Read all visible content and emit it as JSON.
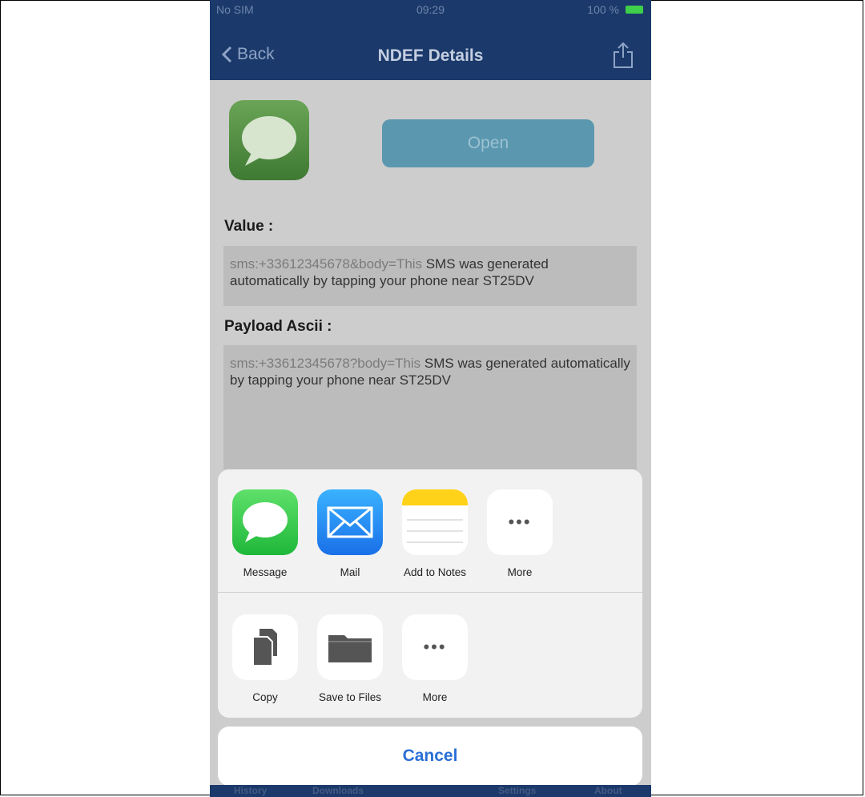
{
  "status": {
    "carrier": "No SIM",
    "time": "09:29",
    "battery": "100 %"
  },
  "nav": {
    "back": "Back",
    "title": "NDEF Details"
  },
  "open_button": "Open",
  "value": {
    "label": "Value :",
    "prefix": "sms:+33612345678&body=This",
    "text": " SMS was generated automatically by tapping your phone near ST25DV"
  },
  "payload": {
    "label": "Payload Ascii :",
    "prefix": "sms:+33612345678?body=This",
    "text": " SMS was generated automatically by tapping your phone near ST25DV"
  },
  "share_apps": [
    {
      "label": "Message",
      "icon": "message-icon"
    },
    {
      "label": "Mail",
      "icon": "mail-icon"
    },
    {
      "label": "Add to Notes",
      "icon": "notes-icon"
    },
    {
      "label": "More",
      "icon": "more-icon"
    }
  ],
  "share_actions": [
    {
      "label": "Copy",
      "icon": "copy-icon"
    },
    {
      "label": "Save to Files",
      "icon": "folder-icon"
    },
    {
      "label": "More",
      "icon": "more-icon"
    }
  ],
  "cancel": "Cancel",
  "tabbar": {
    "items": [
      "History",
      "Downloads",
      "Settings",
      "About"
    ]
  },
  "colors": {
    "nav_bg": "#1b3a6b",
    "accent": "#2a6fd6",
    "open_button": "#5b98b0"
  }
}
